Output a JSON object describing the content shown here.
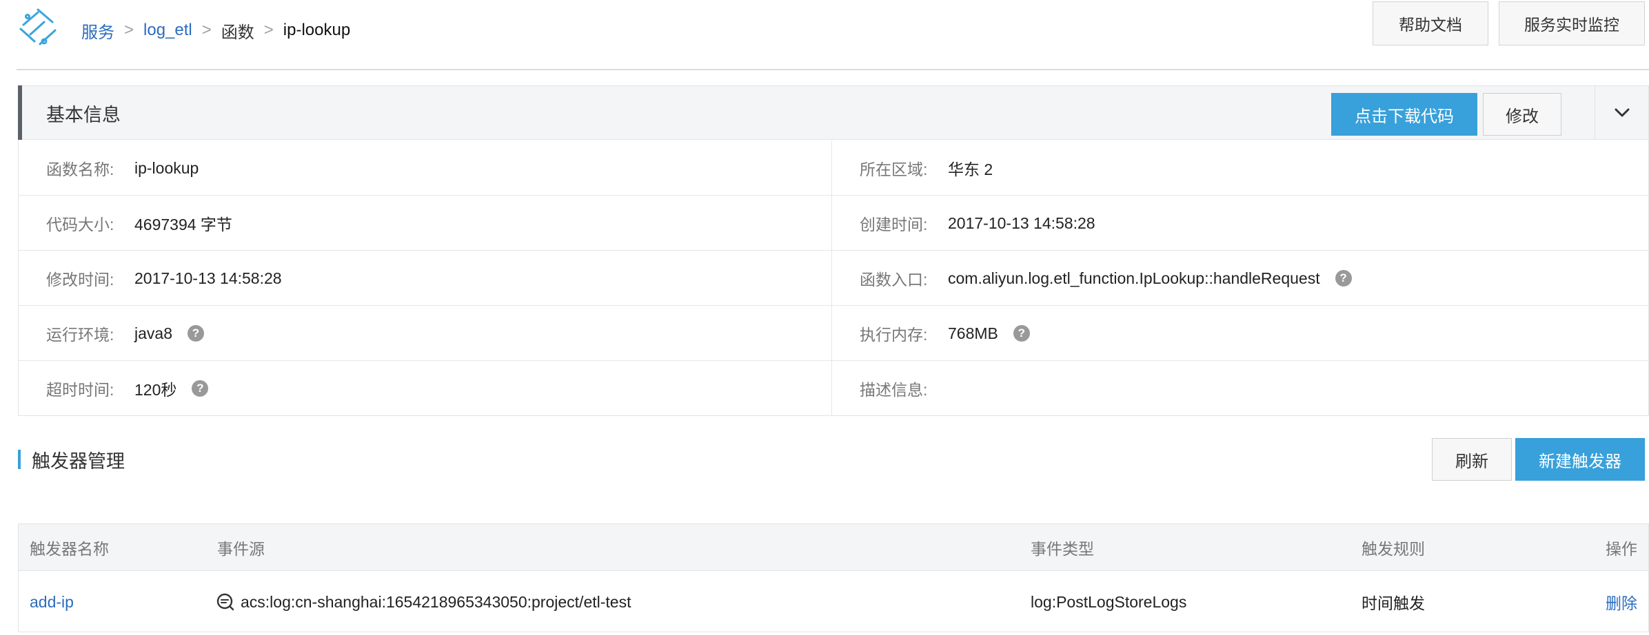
{
  "breadcrumb": {
    "services": "服务",
    "service_name": "log_etl",
    "functions": "函数",
    "current": "ip-lookup",
    "separator": ">"
  },
  "header": {
    "help_docs": "帮助文档",
    "realtime_monitor": "服务实时监控"
  },
  "basic_info": {
    "title": "基本信息",
    "download_code": "点击下载代码",
    "edit": "修改",
    "rows": [
      {
        "left_label": "函数名称:",
        "left_value": "ip-lookup",
        "right_label": "所在区域:",
        "right_value": "华东 2"
      },
      {
        "left_label": "代码大小:",
        "left_value": "4697394 字节",
        "right_label": "创建时间:",
        "right_value": "2017-10-13 14:58:28"
      },
      {
        "left_label": "修改时间:",
        "left_value": "2017-10-13 14:58:28",
        "right_label": "函数入口:",
        "right_value": "com.aliyun.log.etl_function.IpLookup::handleRequest"
      },
      {
        "left_label": "运行环境:",
        "left_value": "java8",
        "right_label": "执行内存:",
        "right_value": "768MB"
      },
      {
        "left_label": "超时时间:",
        "left_value": "120秒",
        "right_label": "描述信息:",
        "right_value": ""
      }
    ]
  },
  "triggers": {
    "title": "触发器管理",
    "refresh": "刷新",
    "create": "新建触发器",
    "columns": {
      "name": "触发器名称",
      "source": "事件源",
      "event_type": "事件类型",
      "rule": "触发规则",
      "actions": "操作"
    },
    "rows": [
      {
        "name": "add-ip",
        "source": "acs:log:cn-shanghai:1654218965343050:project/etl-test",
        "event_type": "log:PostLogStoreLogs",
        "rule": "时间触发",
        "action": "删除"
      }
    ]
  },
  "icons": {
    "logo": "function-compute-logo",
    "help": "question-circle-icon",
    "collapse": "chevron-down-icon",
    "source": "log-service-icon"
  },
  "colors": {
    "primary": "#38a0da",
    "link": "#2b6cbf"
  }
}
